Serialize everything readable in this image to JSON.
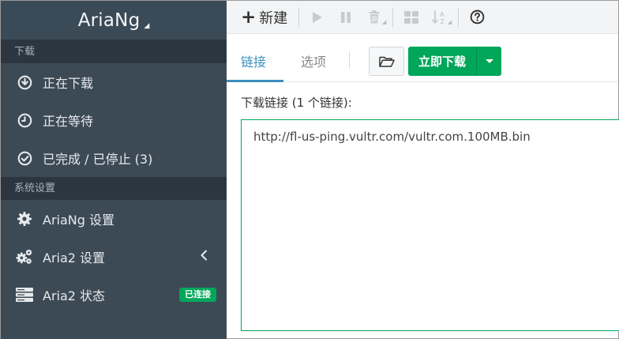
{
  "brand": {
    "name": "AriaNg"
  },
  "sidebar": {
    "section_download": "下载",
    "downloading": "正在下载",
    "waiting": "正在等待",
    "stopped": "已完成 / 已停止 (3)",
    "section_settings": "系统设置",
    "ariang_settings": "AriaNg 设置",
    "aria2_settings": "Aria2 设置",
    "aria2_status": "Aria2 状态",
    "connected_badge": "已连接"
  },
  "toolbar": {
    "new_label": "新建"
  },
  "tabs": {
    "links": "链接",
    "options": "选项"
  },
  "actions": {
    "download_now": "立即下载"
  },
  "form": {
    "label": "下载链接 (1 个链接):",
    "url_value": "http://fl-us-ping.vultr.com/vultr.com.100MB.bin"
  },
  "colors": {
    "sidebar_bg": "#3c4a55",
    "accent_blue": "#3c8dbc",
    "success_green": "#00a65a"
  }
}
